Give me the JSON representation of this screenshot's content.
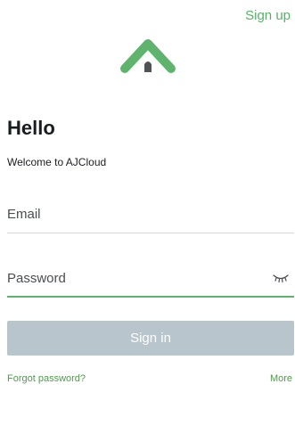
{
  "header": {
    "signup_label": "Sign up",
    "logo_icon": "house-roof-icon"
  },
  "intro": {
    "title": "Hello",
    "subtitle": "Welcome to AJCloud"
  },
  "form": {
    "email_placeholder": "Email",
    "email_value": "",
    "password_placeholder": "Password",
    "password_value": "",
    "password_toggle_icon": "eye-closed-icon",
    "signin_label": "Sign in"
  },
  "footer": {
    "forgot_label": "Forgot password?",
    "more_label": "More"
  },
  "colors": {
    "accent": "#56b265",
    "button_disabled": "#b8c5cd",
    "logo_dark": "#4f5356"
  }
}
